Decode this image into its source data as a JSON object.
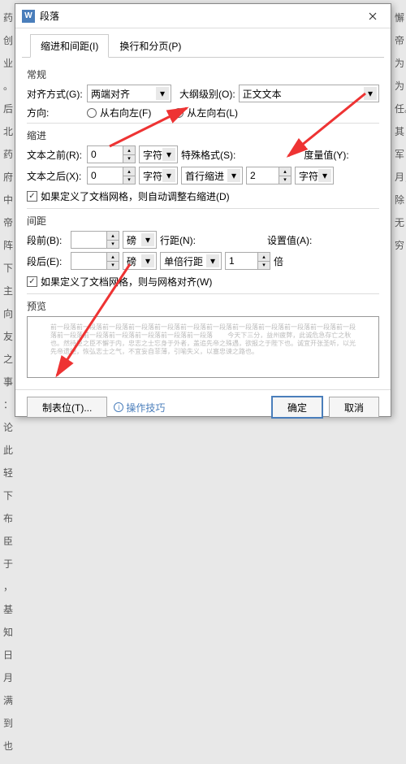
{
  "bg": "药创业\n。后北\n药府中\n帝阵下\n主\n向友\n之事\n：\n论此\n轻下\n布\n臣于\n，基\n知日\n月满\n到也",
  "bg_right": "懈\n帝\n\n\n\n为\n\n为\n\n\n\n任。\n\n其\n军\n\n\n月，\n除\n无穷",
  "dialog": {
    "title": "段落",
    "tabs": [
      "缩进和间距(I)",
      "换行和分页(P)"
    ]
  },
  "general": {
    "label": "常规",
    "align_label": "对齐方式(G):",
    "align_value": "两端对齐",
    "outline_label": "大纲级别(O):",
    "outline_value": "正文文本",
    "dir_label": "方向:",
    "dir_rtl": "从右向左(F)",
    "dir_ltr": "从左向右(L)"
  },
  "indent": {
    "label": "缩进",
    "before_label": "文本之前(R):",
    "before_value": "0",
    "after_label": "文本之后(X):",
    "after_value": "0",
    "unit": "字符",
    "special_label": "特殊格式(S):",
    "special_value": "首行缩进",
    "measure_label": "度量值(Y):",
    "measure_value": "2",
    "measure_unit": "字符",
    "grid_check": "如果定义了文档网格，则自动调整右缩进(D)"
  },
  "spacing": {
    "label": "间距",
    "before_label": "段前(B):",
    "before_value": "",
    "after_label": "段后(E):",
    "after_value": "",
    "unit": "磅",
    "linespace_label": "行距(N):",
    "linespace_value": "单倍行距",
    "setat_label": "设置值(A):",
    "setat_value": "1",
    "setat_unit": "倍",
    "grid_check": "如果定义了文档网格，则与网格对齐(W)"
  },
  "preview": {
    "label": "预览",
    "text": "前一段落前一段落前一段落前一段落前一段落前一段落前一段落前一段落前一段落前一段落前一段落前一段落前一段落前一段落前一段落前一段落前一段落前一段落\n　　今天下三分，益州疲弊，此诚危急存亡之秋也。然待臣之臣不懈于内，忠志之士忘身于外者，盖追先帝之殊遇，欲报之于陛下也。诚宜开张圣听，以光先帝遗德，恢弘志士之气，不宜妄自菲薄，引喻失义，以塞忠谏之路也。"
  },
  "buttons": {
    "tabstops": "制表位(T)...",
    "tips": "操作技巧",
    "ok": "确定",
    "cancel": "取消"
  }
}
